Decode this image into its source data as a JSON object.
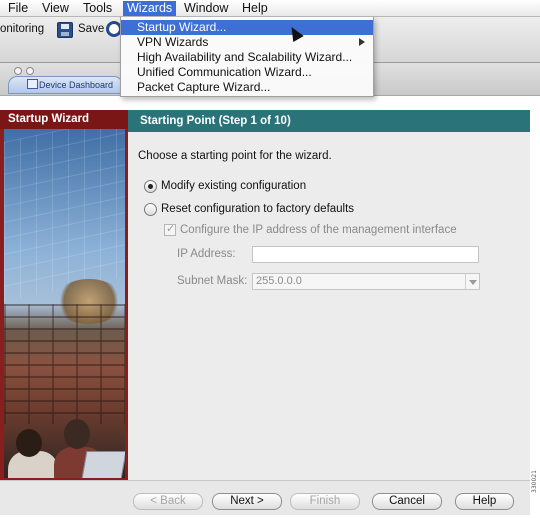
{
  "menubar": {
    "items": [
      "File",
      "View",
      "Tools",
      "Wizards",
      "Window",
      "Help"
    ]
  },
  "toolbar": {
    "monitoring_label": "onitoring",
    "save_label": "Save",
    "device_tab_label": "Device Dashboard"
  },
  "wizards_menu": {
    "items": [
      "Startup Wizard...",
      "VPN Wizards",
      "High Availability and Scalability Wizard...",
      "Unified Communication Wizard...",
      "Packet Capture Wizard..."
    ]
  },
  "wizard": {
    "sidebar_title": "Startup Wizard",
    "header": "Starting Point  (Step 1 of 10)",
    "prompt": "Choose a starting point for the wizard.",
    "option_modify": "Modify existing configuration",
    "option_reset": "Reset configuration to factory defaults",
    "checkbox_label": "Configure the IP address of the management interface",
    "ip_label": "IP Address:",
    "ip_value": "",
    "subnet_label": "Subnet Mask:",
    "subnet_value": "255.0.0.0",
    "buttons": {
      "back": "< Back",
      "next": "Next >",
      "finish": "Finish",
      "cancel": "Cancel",
      "help": "Help"
    }
  },
  "figure_code": "330021"
}
